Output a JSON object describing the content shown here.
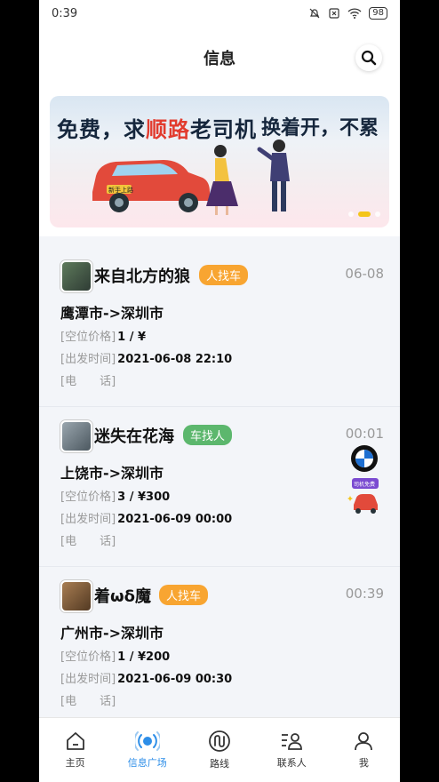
{
  "status": {
    "time": "0:39",
    "battery": "98"
  },
  "header": {
    "title": "信息"
  },
  "banner": {
    "left_pre": "免费，求",
    "left_hl": "顺路",
    "left_post": "老司机",
    "right": "换着开，不累",
    "car_plate": "新手上路"
  },
  "posts": [
    {
      "name": "来自北方的狼",
      "tag": "人找车",
      "time": "06-08",
      "route": "鹰潭市->深圳市",
      "price_label": "[空位价格]",
      "price": "1 / ¥",
      "depart_label": "[出发时间]",
      "depart": "2021-06-08 22:10",
      "phone_label": "[电　　话]"
    },
    {
      "name": "迷失在花海",
      "tag": "车找人",
      "time": "00:01",
      "route": "上饶市->深圳市",
      "price_label": "[空位价格]",
      "price": "3 / ¥300",
      "depart_label": "[出发时间]",
      "depart": "2021-06-09 00:00",
      "phone_label": "[电　　话]",
      "promo_text": "司机免费"
    },
    {
      "name": "着ωδ魔",
      "tag": "人找车",
      "time": "00:39",
      "route": "广州市->深圳市",
      "price_label": "[空位价格]",
      "price": "1 / ¥200",
      "depart_label": "[出发时间]",
      "depart": "2021-06-09 00:30",
      "phone_label": "[电　　话]"
    }
  ],
  "tabs": [
    {
      "label": "主页",
      "icon": "home-icon"
    },
    {
      "label": "信息广场",
      "icon": "broadcast-icon",
      "active": true
    },
    {
      "label": "路线",
      "icon": "route-icon"
    },
    {
      "label": "联系人",
      "icon": "contacts-icon"
    },
    {
      "label": "我",
      "icon": "profile-icon"
    }
  ],
  "colors": {
    "accent": "#2d8ee8",
    "tag_orange": "#f8a531",
    "tag_green": "#5cb76d",
    "dot_active": "#f4c51a"
  }
}
